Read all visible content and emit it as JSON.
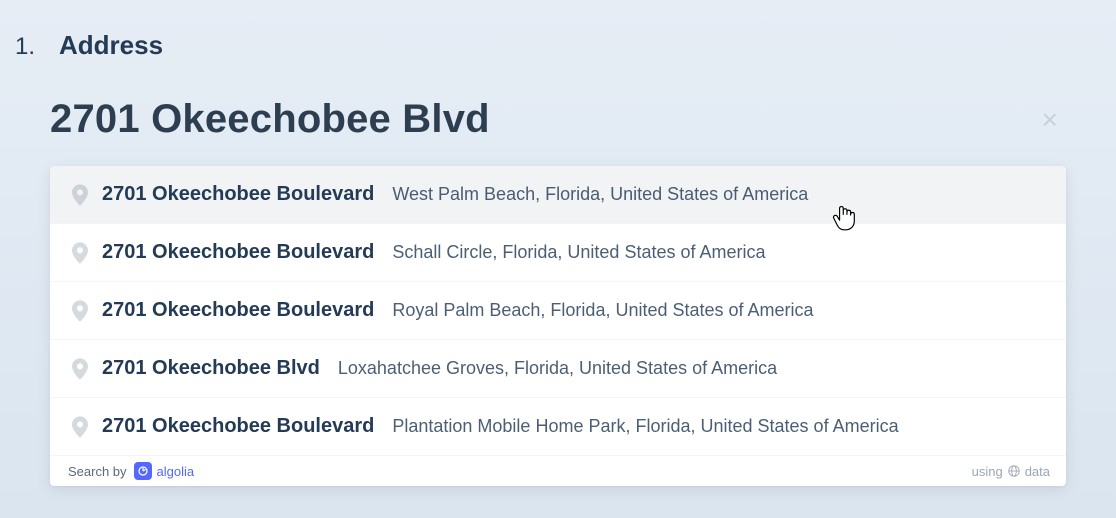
{
  "step": {
    "number": "1.",
    "label": "Address"
  },
  "search": {
    "value": "2701 Okeechobee Blvd",
    "clear_label": "×"
  },
  "suggestions": [
    {
      "main": "2701 Okeechobee Boulevard",
      "secondary": "West Palm Beach, Florida, United States of America",
      "highlighted": true
    },
    {
      "main": "2701 Okeechobee Boulevard",
      "secondary": "Schall Circle, Florida, United States of America",
      "highlighted": false
    },
    {
      "main": "2701 Okeechobee Boulevard",
      "secondary": "Royal Palm Beach, Florida, United States of America",
      "highlighted": false
    },
    {
      "main": "2701 Okeechobee Blvd",
      "secondary": "Loxahatchee Groves, Florida, United States of America",
      "highlighted": false
    },
    {
      "main": "2701 Okeechobee Boulevard",
      "secondary": "Plantation Mobile Home Park, Florida, United States of America",
      "highlighted": false
    }
  ],
  "footer": {
    "search_by": "Search by",
    "provider": "algolia",
    "using": "using",
    "data": "data"
  }
}
